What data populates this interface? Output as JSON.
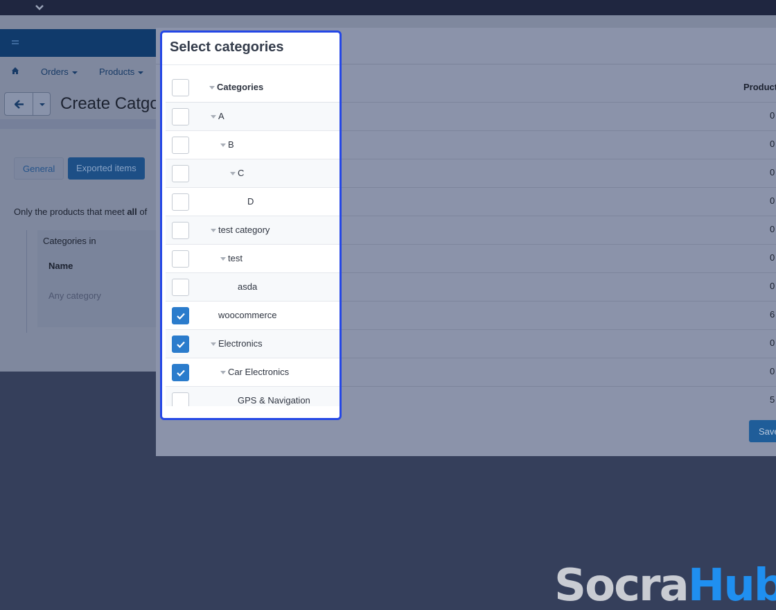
{
  "nav": {
    "orders": "Orders",
    "products": "Products"
  },
  "page": {
    "title": "Create Catgo",
    "tabs": {
      "general": "General",
      "exported": "Exported items"
    },
    "filter_text_pre": "Only the products that meet ",
    "filter_text_bold": "all",
    "filter_text_post": " of",
    "condition": {
      "title": "Categories in",
      "name_label": "Name",
      "any": "Any category"
    }
  },
  "modal": {
    "title": "Select categories",
    "column_categories": "Categories",
    "column_products": "Product",
    "save_label": "Save",
    "rows": [
      {
        "label": "A",
        "count": "0",
        "checked": false
      },
      {
        "label": "B",
        "count": "0",
        "checked": false
      },
      {
        "label": "C",
        "count": "0",
        "checked": false
      },
      {
        "label": "D",
        "count": "0",
        "checked": false
      },
      {
        "label": "test category",
        "count": "0",
        "checked": false
      },
      {
        "label": "test",
        "count": "0",
        "checked": false
      },
      {
        "label": "asda",
        "count": "0",
        "checked": false
      },
      {
        "label": "woocommerce",
        "count": "6",
        "checked": true
      },
      {
        "label": "Electronics",
        "count": "0",
        "checked": true
      },
      {
        "label": "Car Electronics",
        "count": "0",
        "checked": true
      },
      {
        "label": "GPS & Navigation",
        "count": "5",
        "checked": false
      }
    ]
  },
  "watermark": {
    "part1": "Socra",
    "part2": "Hub"
  },
  "colors": {
    "accent": "#2447e6",
    "checked": "#2b7ccc",
    "overlay": "#353f5b"
  }
}
